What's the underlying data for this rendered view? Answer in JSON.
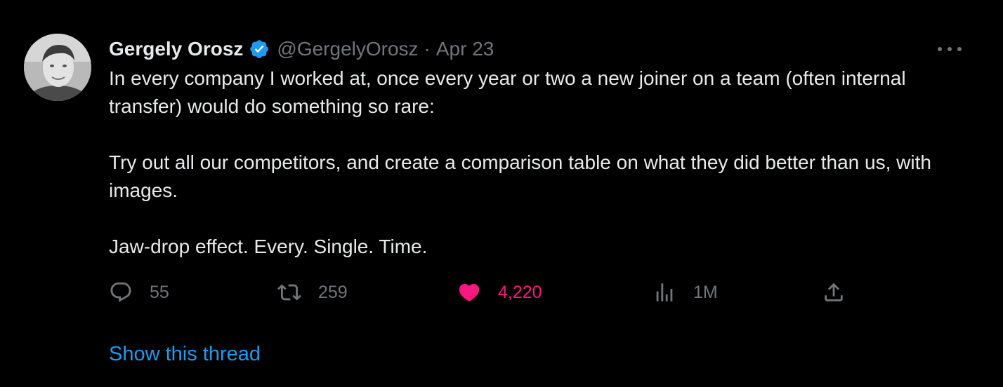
{
  "author": {
    "display_name": "Gergely Orosz",
    "handle": "@GergelyOrosz",
    "separator": "·",
    "date": "Apr 23",
    "verified": true
  },
  "tweet": {
    "paragraphs": [
      "In every company I worked at, once every year or two a new joiner on a team (often internal transfer) would do something so rare:",
      "Try out all our competitors, and create a comparison table on what they did better than us, with images.",
      "Jaw-drop effect. Every. Single. Time."
    ]
  },
  "actions": {
    "reply_count": "55",
    "retweet_count": "259",
    "like_count": "4,220",
    "views_count": "1M"
  },
  "footer": {
    "show_thread_label": "Show this thread"
  },
  "colors": {
    "background": "#000000",
    "text": "#e7e9ea",
    "secondary": "#71767b",
    "like": "#f91880",
    "link": "#1d9bf0",
    "verified": "#1d9bf0"
  },
  "icons": {
    "reply": "speech-bubble-icon",
    "retweet": "retweet-icon",
    "like": "heart-icon",
    "views": "bar-chart-icon",
    "share": "share-upload-icon",
    "more": "more-horizontal-icon",
    "verified": "verified-badge-icon"
  }
}
